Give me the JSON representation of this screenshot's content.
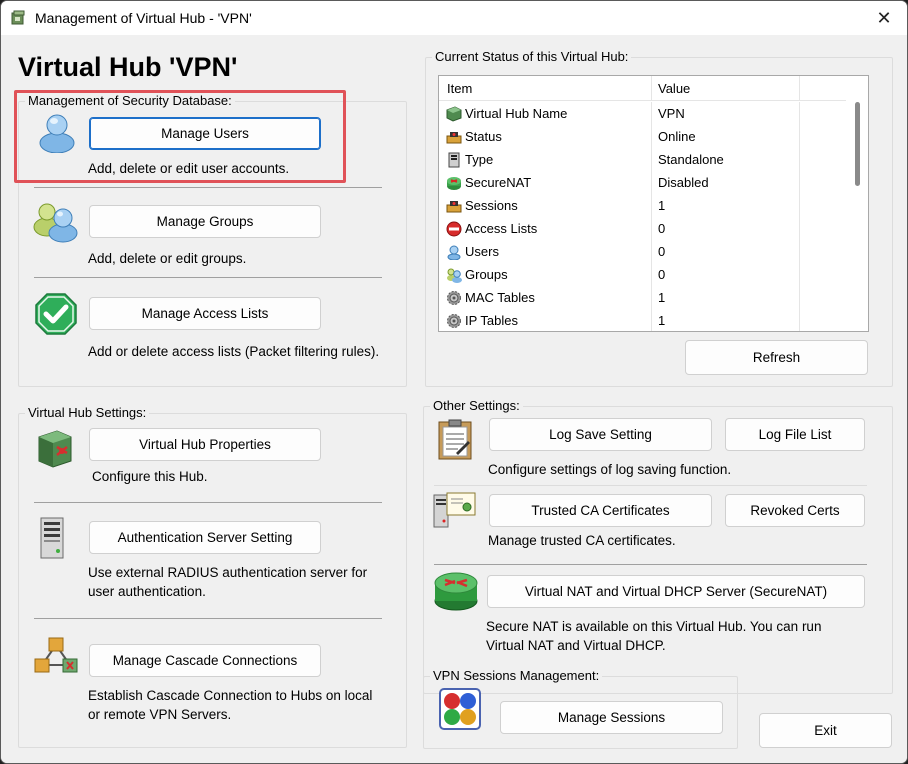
{
  "window": {
    "title": "Management of Virtual Hub - 'VPN'",
    "close_symbol": "✕"
  },
  "page_title": "Virtual Hub 'VPN'",
  "security_db": {
    "label": "Management of Security Database:",
    "manage_users": {
      "label": "Manage Users",
      "desc": "Add, delete or edit user accounts."
    },
    "manage_groups": {
      "label": "Manage Groups",
      "desc": "Add, delete or edit groups."
    },
    "manage_access_lists": {
      "label": "Manage Access Lists",
      "desc": "Add or delete access lists (Packet filtering rules)."
    }
  },
  "hub_settings": {
    "label": "Virtual Hub Settings:",
    "properties": {
      "label": "Virtual Hub Properties",
      "desc": "Configure this Hub."
    },
    "auth_server": {
      "label": "Authentication Server Setting",
      "desc_line1": "Use external RADIUS authentication server for",
      "desc_line2": "user authentication."
    },
    "cascade": {
      "label": "Manage Cascade Connections",
      "desc_line1": "Establish Cascade Connection to Hubs on local",
      "desc_line2": "or remote VPN Servers."
    }
  },
  "status": {
    "label": "Current Status of this Virtual Hub:",
    "columns": {
      "item": "Item",
      "value": "Value"
    },
    "rows": [
      {
        "item": "Virtual Hub Name",
        "value": "VPN",
        "icon": "hub-icon"
      },
      {
        "item": "Status",
        "value": "Online",
        "icon": "status-icon"
      },
      {
        "item": "Type",
        "value": "Standalone",
        "icon": "server-icon"
      },
      {
        "item": "SecureNAT",
        "value": "Disabled",
        "icon": "router-icon"
      },
      {
        "item": "Sessions",
        "value": "1",
        "icon": "sessions-icon"
      },
      {
        "item": "Access Lists",
        "value": "0",
        "icon": "stop-icon"
      },
      {
        "item": "Users",
        "value": "0",
        "icon": "user-icon"
      },
      {
        "item": "Groups",
        "value": "0",
        "icon": "group-icon"
      },
      {
        "item": "MAC Tables",
        "value": "1",
        "icon": "gear-icon"
      },
      {
        "item": "IP Tables",
        "value": "1",
        "icon": "gear-icon"
      }
    ],
    "refresh_label": "Refresh"
  },
  "other_settings": {
    "label": "Other Settings:",
    "log_save": {
      "label": "Log Save Setting",
      "desc": "Configure settings of log saving function."
    },
    "log_file_list": {
      "label": "Log File List"
    },
    "trusted_ca": {
      "label": "Trusted CA Certificates",
      "desc": "Manage trusted CA certificates."
    },
    "revoked": {
      "label": "Revoked Certs"
    },
    "securenat": {
      "label": "Virtual NAT and Virtual DHCP Server (SecureNAT)",
      "desc_line1": "Secure NAT is available on this Virtual Hub. You can run",
      "desc_line2": "Virtual NAT and Virtual DHCP."
    }
  },
  "sessions_mgmt": {
    "label": "VPN Sessions Management:",
    "manage_sessions": {
      "label": "Manage Sessions"
    }
  },
  "exit_label": "Exit",
  "colors": {
    "highlight": "#e05258",
    "focus_border": "#1d6fc9",
    "window_bg": "#f0f0f0"
  }
}
